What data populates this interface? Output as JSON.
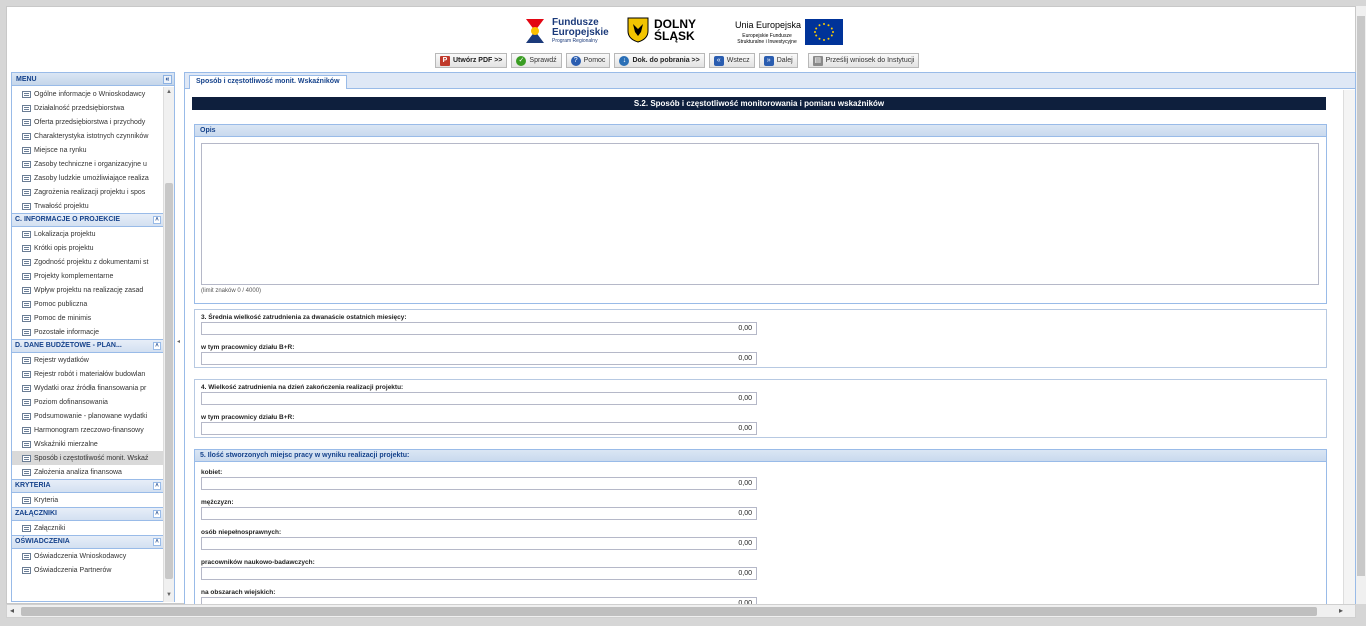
{
  "header": {
    "fe_title": "Fundusze Europejskie",
    "fe_sub": "Program Regionalny",
    "ds_title": "DOLNY ŚLĄSK",
    "ue_title": "Unia Europejska",
    "ue_sub": "Europejskie Fundusze Strukturalne i Inwestycyjne"
  },
  "toolbar": {
    "pdf": "Utwórz PDF >>",
    "check": "Sprawdź",
    "help": "Pomoc",
    "docs": "Dok. do pobrania >>",
    "back": "Wstecz",
    "next": "Dalej",
    "send": "Prześlij wniosek do Instytucji"
  },
  "sidebar": {
    "title": "MENU",
    "top_items": [
      "Ogólne informacje o Wnioskodawcy",
      "Działalność przedsiębiorstwa",
      "Oferta przedsiębiorstwa i przychody",
      "Charakterystyka istotnych czynników",
      "Miejsce na rynku",
      "Zasoby techniczne i organizacyjne u",
      "Zasoby ludzkie umożliwiające realiza",
      "Zagrożenia realizacji projektu i spos",
      "Trwałość projektu"
    ],
    "sections": [
      {
        "title": "C. INFORMACJE O PROJEKCIE",
        "items": [
          "Lokalizacja projektu",
          "Krótki opis projektu",
          "Zgodność projektu z dokumentami st",
          "Projekty komplementarne",
          "Wpływ projektu na realizację zasad",
          "Pomoc publiczna",
          "Pomoc de minimis",
          "Pozostałe informacje"
        ]
      },
      {
        "title": "D. DANE BUDŻETOWE - PLAN...",
        "items": [
          "Rejestr wydatków",
          "Rejestr robót i materiałów budowlan",
          "Wydatki oraz źródła finansowania pr",
          "Poziom dofinansowania",
          "Podsumowanie - planowane wydatki",
          "Harmonogram rzeczowo-finansowy",
          "Wskaźniki mierzalne",
          "Sposób i częstotliwość monit. Wskaź",
          "Założenia analiza finansowa"
        ]
      },
      {
        "title": "KRYTERIA",
        "items": [
          "Kryteria"
        ]
      },
      {
        "title": "ZAŁĄCZNIKI",
        "items": [
          "Załączniki"
        ]
      },
      {
        "title": "OŚWIADCZENIA",
        "items": [
          "Oświadczenia Wnioskodawcy",
          "Oświadczenia Partnerów"
        ]
      }
    ]
  },
  "main": {
    "tab": "Sposób i częstotliwość monit. Wskaźników",
    "section_title": "S.2. Sposób i częstotliwość monitorowania i pomiaru wskaźników",
    "opis": {
      "label": "Opis",
      "limit": "(limit znaków 0 / 4000)"
    },
    "g3": {
      "title": "3. Średnia wielkość zatrudnienia za dwanaście ostatnich miesięcy:",
      "sub_label": "w tym pracownicy działu B+R:",
      "v1": "0,00",
      "v2": "0,00"
    },
    "g4": {
      "title": "4. Wielkość zatrudnienia na dzień zakończenia realizacji projektu:",
      "sub_label": "w tym pracownicy działu B+R:",
      "v1": "0,00",
      "v2": "0,00"
    },
    "g5": {
      "title": "5. Ilość stworzonych miejsc pracy w wyniku realizacji projektu:",
      "rows": [
        {
          "label": "kobiet:",
          "value": "0,00"
        },
        {
          "label": "mężczyzn:",
          "value": "0,00"
        },
        {
          "label": "osób niepełnosprawnych:",
          "value": "0,00"
        },
        {
          "label": "pracowników naukowo-badawczych:",
          "value": "0,00"
        },
        {
          "label": "na obszarach wiejskich:",
          "value": "0,00"
        }
      ]
    }
  },
  "colors": {
    "accent": "#15428b",
    "title_bar": "#0e1f3d",
    "border": "#99bbe8"
  }
}
